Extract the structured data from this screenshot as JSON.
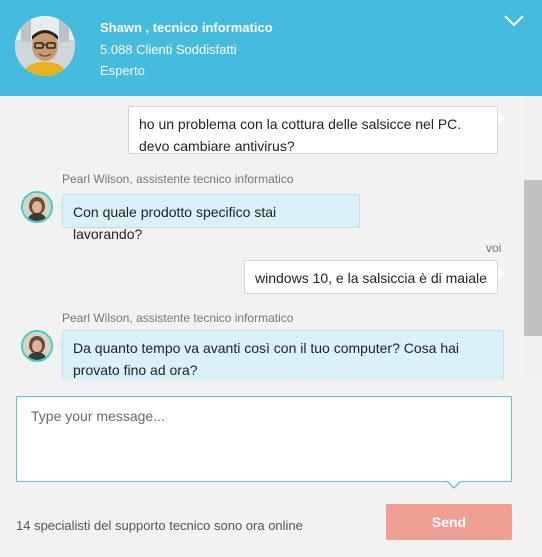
{
  "expert": {
    "name": "Shawn , tecnico informatico",
    "clients": "5.088 Clienti Soddisfatti",
    "level": "Esperto"
  },
  "assistant": {
    "label": "Pearl Wilson, assistente tecnico informatico"
  },
  "user": {
    "label": "voi"
  },
  "messages": [
    {
      "from": "user",
      "lines": [
        "ho un problema con la cottura delle salsicce nel PC.",
        "devo cambiare antivirus?"
      ]
    },
    {
      "from": "assistant",
      "lines": [
        "Con quale prodotto specifico stai lavorando?"
      ]
    },
    {
      "from": "user",
      "lines": [
        "windows 10, e la salsiccia è di maiale"
      ]
    },
    {
      "from": "assistant",
      "lines": [
        "Da quanto tempo va avanti così con il tuo computer? Cosa hai",
        "provato fino ad ora?"
      ]
    }
  ],
  "composer": {
    "placeholder": "Type your message...",
    "online_status": "14 specialisti del supporto tecnico sono ora online",
    "send_label": "Send"
  },
  "icons": {
    "collapse": "chevron-down-icon"
  },
  "colors": {
    "header": "#45bcdd",
    "agent_bubble": "#daf1f9",
    "send_button": "#eda093",
    "avatar_ring": "#3ed0c1"
  }
}
